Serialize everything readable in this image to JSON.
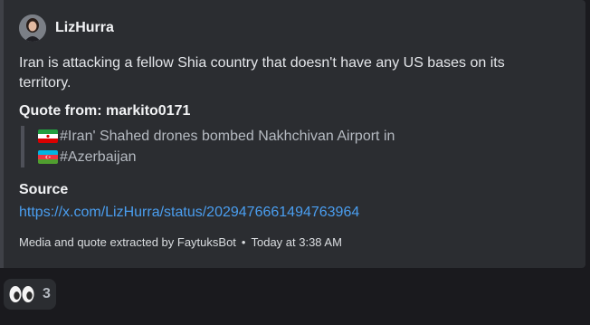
{
  "author": {
    "name": "LizHurra",
    "avatar_icon": "user-avatar-photo"
  },
  "post": {
    "text": "Iran is attacking a fellow Shia country that doesn't have any US bases on its territory."
  },
  "quote": {
    "heading": "Quote from: markito0171",
    "lines": [
      {
        "flag_icon": "iran-flag-icon",
        "text": "#Iran' Shahed drones bombed Nakhchivan Airport in"
      },
      {
        "flag_icon": "azerbaijan-flag-icon",
        "text": "#Azerbaijan"
      }
    ]
  },
  "source": {
    "heading": "Source",
    "link": "https://x.com/LizHurra/status/2029476661494763964"
  },
  "footer": {
    "bot_text": "Media and quote extracted by FaytuksBot",
    "separator": "•",
    "timestamp": "Today at 3:38 AM"
  },
  "reaction": {
    "emoji_icon": "eyes-emoji-icon",
    "count": "3"
  },
  "colors": {
    "background": "#1a1a1e",
    "embed": "#2b2d31",
    "link": "#4a9ef0",
    "text": "#e4e6ea"
  }
}
